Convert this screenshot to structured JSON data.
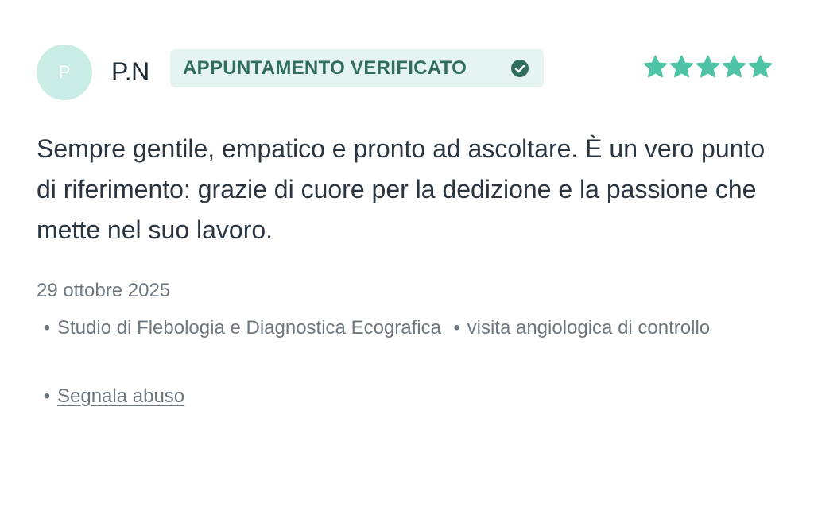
{
  "review": {
    "avatar_initial": "P",
    "author": "P.N",
    "badge_label": "APPUNTAMENTO VERIFICATO",
    "rating": 5,
    "rating_max": 5,
    "comment": "Sempre gentile, empatico e pronto ad ascoltare. È un vero punto di riferimento: grazie di cuore per la dedizione e la passione che mette nel suo lavoro.",
    "date": "29 ottobre 2025",
    "bullet": "•",
    "clinic": "Studio di Flebologia e Diagnostica Ecografica",
    "service": "visita angiologica di controllo",
    "report_link": "Segnala abuso"
  },
  "colors": {
    "accent": "#4fc3a5",
    "badge_bg": "#e6f4f1",
    "badge_text": "#2f6e5d",
    "avatar_bg": "#c9ece4"
  },
  "icons": {
    "verified": "check-circle-icon",
    "rating": "star-icon"
  }
}
